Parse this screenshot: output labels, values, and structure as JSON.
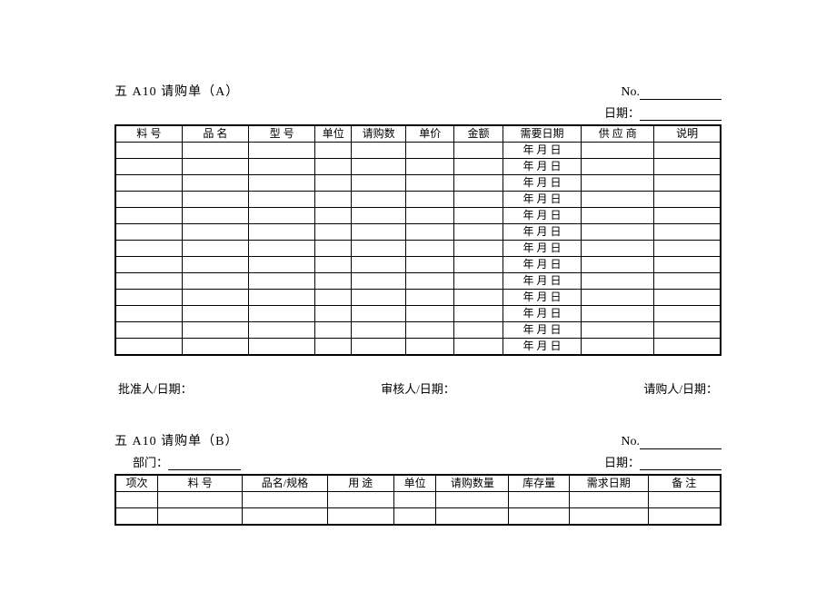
{
  "formA": {
    "title": "五 A10  请购单（A）",
    "noLabel": "No.",
    "dateLabel": "日期：",
    "headers": {
      "liaohao": "料    号",
      "pinming": "品   名",
      "xinghao": "型   号",
      "danwei": "单位",
      "qinggoushu": "请购数",
      "danjia": "单价",
      "jine": "金额",
      "xuyaoriqi": "需要日期",
      "gongyingshang": "供 应 商",
      "shuoming": "说明"
    },
    "dateCell": "年  月  日",
    "rowCount": 13,
    "footer": {
      "approver": "批准人/日期：",
      "reviewer": "审核人/日期：",
      "requester": "请购人/日期："
    }
  },
  "formB": {
    "title": "五 A10  请购单（B）",
    "noLabel": "No.",
    "deptLabel": "部门：",
    "dateLabel": "日期：",
    "headers": {
      "xiangci": "项次",
      "liaohao": "料   号",
      "pinmingguige": "品名/规格",
      "yongtu": "用  途",
      "danwei": "单位",
      "qinggoushuliang": "请购数量",
      "kucunliang": "库存量",
      "xuqiuriqi": "需求日期",
      "beizhu": "备  注"
    },
    "rowCount": 2
  }
}
